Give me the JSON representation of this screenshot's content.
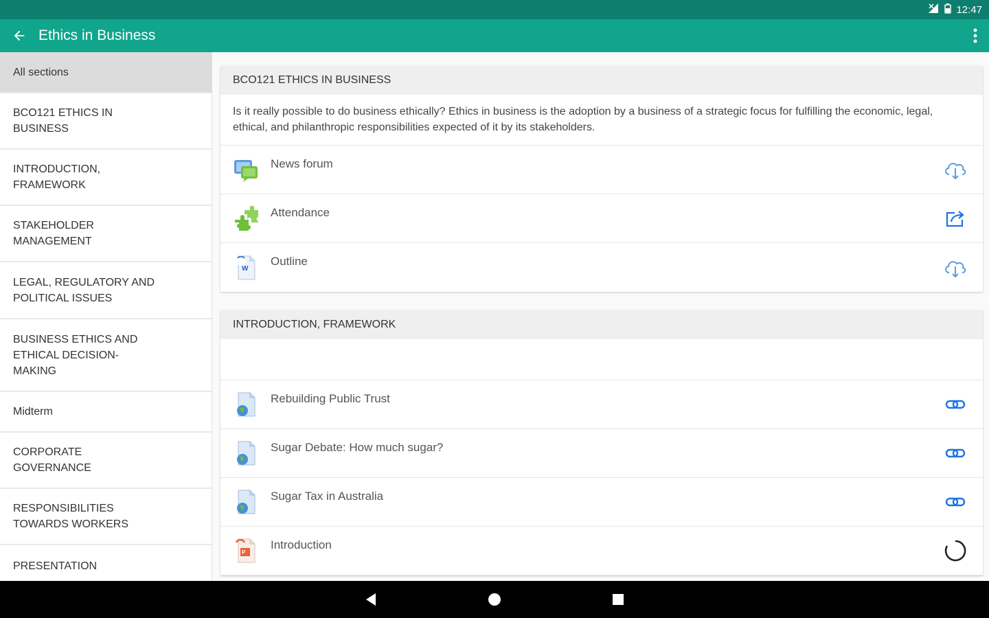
{
  "status": {
    "time": "12:47"
  },
  "appbar": {
    "title": "Ethics in Business"
  },
  "sidebar": {
    "items": [
      {
        "label": "All sections",
        "active": true
      },
      {
        "label": "BCO121 ETHICS IN BUSINESS"
      },
      {
        "label": "INTRODUCTION, FRAMEWORK"
      },
      {
        "label": "STAKEHOLDER MANAGEMENT"
      },
      {
        "label": "LEGAL, REGULATORY AND POLITICAL ISSUES"
      },
      {
        "label": "BUSINESS ETHICS AND ETHICAL DECISION-MAKING"
      },
      {
        "label": "Midterm"
      },
      {
        "label": "CORPORATE GOVERNANCE"
      },
      {
        "label": "RESPONSIBILITIES TOWARDS WORKERS"
      },
      {
        "label": "PRESENTATION"
      }
    ]
  },
  "sections": [
    {
      "title": "BCO121 ETHICS IN BUSINESS",
      "description": "Is it really possible to do business ethically? Ethics in business is the adoption by a business of a strategic focus for fulfilling the economic, legal, ethical, and philanthropic responsibilities expected of it by its stakeholders.",
      "modules": [
        {
          "name": "News forum",
          "icon": "forum-icon",
          "action": "cloud-download-icon"
        },
        {
          "name": "Attendance",
          "icon": "puzzle-icon",
          "action": "open-external-icon"
        },
        {
          "name": "Outline",
          "icon": "word-document-icon",
          "action": "cloud-download-icon"
        }
      ]
    },
    {
      "title": "INTRODUCTION, FRAMEWORK",
      "modules": [
        {
          "name": "Rebuilding Public Trust",
          "icon": "url-document-icon",
          "action": "link-icon"
        },
        {
          "name": "Sugar Debate: How much sugar?",
          "icon": "url-document-icon",
          "action": "link-icon"
        },
        {
          "name": "Sugar Tax in Australia",
          "icon": "url-document-icon",
          "action": "link-icon"
        },
        {
          "name": "Introduction",
          "icon": "powerpoint-document-icon",
          "action": "loading-spinner-icon"
        }
      ]
    }
  ],
  "colors": {
    "statusbar": "#0e7f6e",
    "appbar": "#10a58c",
    "action": "#1a73e8"
  }
}
